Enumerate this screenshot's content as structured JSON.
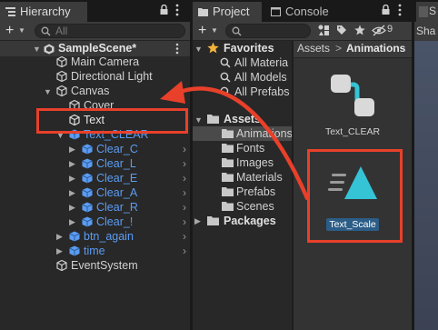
{
  "hierarchy": {
    "tab_label": "Hierarchy",
    "search_placeholder": "All",
    "scene_name": "SampleScene*",
    "items": {
      "main_camera": "Main Camera",
      "directional_light": "Directional Light",
      "canvas": "Canvas",
      "cover": "Cover",
      "text": "Text",
      "text_clear": "Text_CLEAR",
      "clear_c": "Clear_C",
      "clear_l": "Clear_L",
      "clear_e": "Clear_E",
      "clear_a": "Clear_A",
      "clear_r": "Clear_R",
      "clear_excl": "Clear_!",
      "btn_again": "btn_again",
      "time": "time",
      "event_system": "EventSystem"
    }
  },
  "project": {
    "tab_label": "Project",
    "console_tab_label": "Console",
    "hidden_count": "9",
    "favorites": {
      "header": "Favorites",
      "items": [
        "All Materia",
        "All Models",
        "All Prefabs"
      ]
    },
    "assets": {
      "header": "Assets",
      "folders": [
        "Animations",
        "Fonts",
        "Images",
        "Materials",
        "Prefabs",
        "Scenes"
      ]
    },
    "packages_header": "Packages",
    "breadcrumb": {
      "root": "Assets",
      "separator": ">",
      "current": "Animations"
    },
    "asset_items": [
      {
        "name": "Text_CLEAR",
        "type": "animator-controller"
      },
      {
        "name": "Text_Scale",
        "type": "animation-clip",
        "selected": true
      }
    ]
  },
  "scene": {
    "tab_partial": "S",
    "shading_partial": "Sha"
  },
  "colors": {
    "annotation_red": "#e8402a",
    "prefab_blue": "#5b9cf2",
    "selection_blue": "#2c5d87",
    "anim_teal": "#35c3d6"
  }
}
